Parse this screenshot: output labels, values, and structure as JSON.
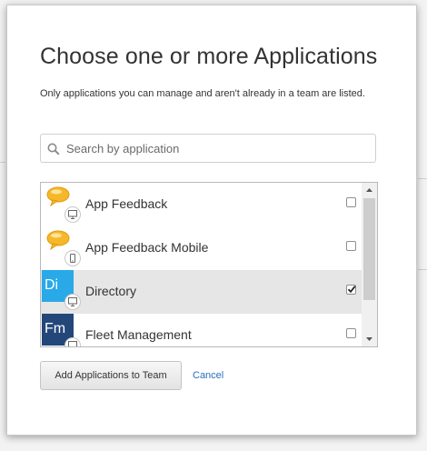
{
  "dialog": {
    "title": "Choose one or more Applications",
    "subtitle": "Only applications you can manage and aren't already in a team are listed."
  },
  "search": {
    "placeholder": "Search by application",
    "value": "",
    "icon": "search-icon"
  },
  "apps": [
    {
      "name": "App Feedback",
      "icon": "speech-bubble-icon",
      "platform": "desktop-icon",
      "checked": false
    },
    {
      "name": "App Feedback Mobile",
      "icon": "speech-bubble-icon",
      "platform": "mobile-icon",
      "checked": false
    },
    {
      "name": "Directory",
      "tile_text": "Di",
      "tile_color": "#29a9e8",
      "platform": "desktop-icon",
      "checked": true,
      "selected": true
    },
    {
      "name": "Fleet Management",
      "tile_text": "Fm",
      "tile_color": "#24477a",
      "platform": "desktop-icon",
      "checked": false
    }
  ],
  "actions": {
    "add_label": "Add Applications to Team",
    "cancel_label": "Cancel"
  },
  "colors": {
    "link": "#2a6fbf",
    "selected_row": "#e6e6e6",
    "bubble": "#f6b829"
  }
}
